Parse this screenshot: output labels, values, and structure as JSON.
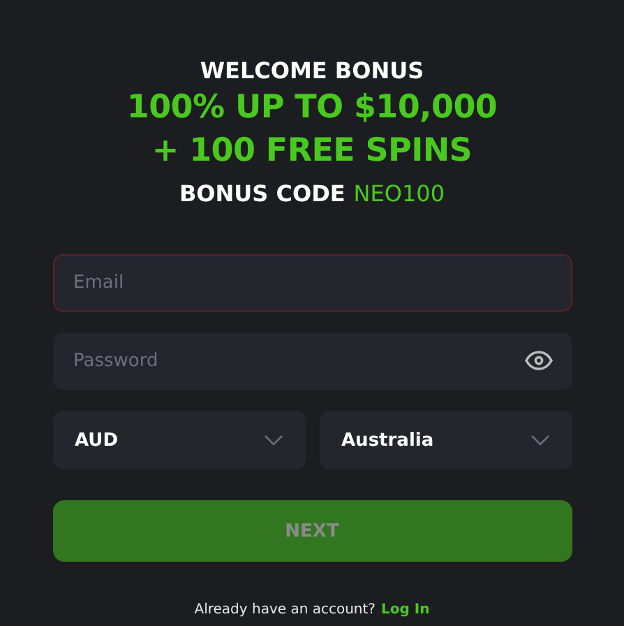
{
  "promo": {
    "title": "WELCOME BONUS",
    "headline": [
      "100% UP TO $10,000",
      "+ 100 FREE SPINS"
    ],
    "code_label": "BONUS CODE",
    "code": "NEO100"
  },
  "fields": [
    {
      "kind": "text",
      "placeholder": "Email",
      "invalid": true
    },
    {
      "kind": "password",
      "placeholder": "Password",
      "invalid": false
    }
  ],
  "selects": [
    {
      "value": "AUD"
    },
    {
      "value": "Australia"
    }
  ],
  "next_button": {
    "label": "NEXT",
    "disabled": true
  },
  "footer": {
    "text": "Already have an account?",
    "link": "Log In"
  }
}
